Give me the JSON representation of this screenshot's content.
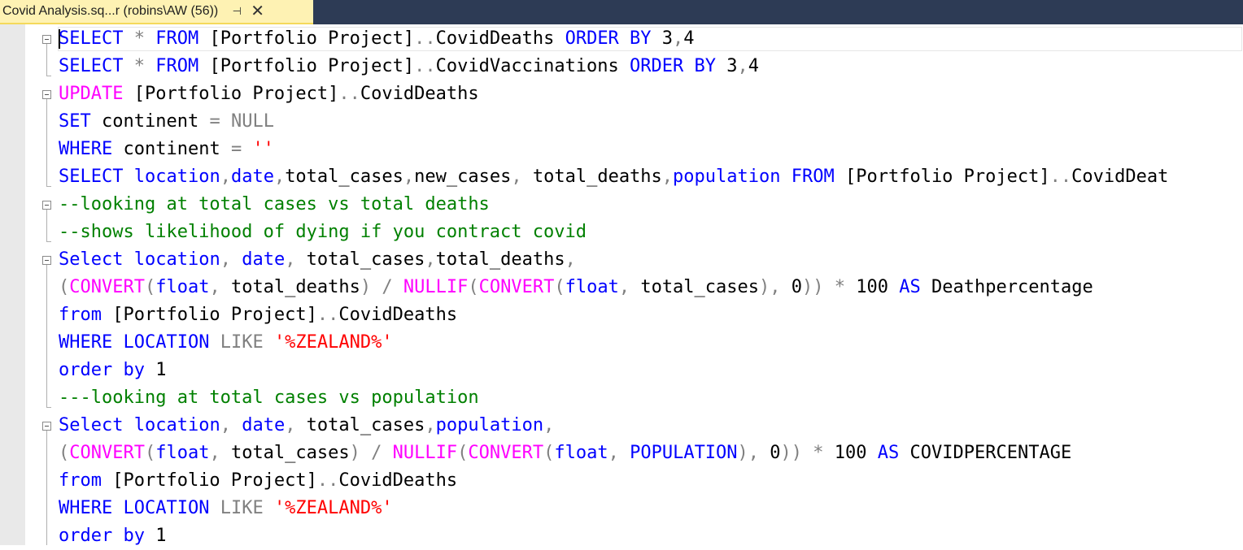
{
  "tab": {
    "title": "Covid Analysis.sq...r (robins\\AW (56))",
    "pin_icon": "⊣",
    "close_icon": "✕"
  },
  "editor": {
    "lines": [
      [
        [
          "kw",
          "SELECT"
        ],
        [
          "tx",
          " "
        ],
        [
          "op",
          "*"
        ],
        [
          "tx",
          " "
        ],
        [
          "kw",
          "FROM"
        ],
        [
          "tx",
          " [Portfolio Project]"
        ],
        [
          "op",
          ".."
        ],
        [
          "tx",
          "CovidDeaths "
        ],
        [
          "kw",
          "ORDER BY"
        ],
        [
          "tx",
          " 3"
        ],
        [
          "op",
          ","
        ],
        [
          "tx",
          "4"
        ]
      ],
      [
        [
          "kw",
          "SELECT"
        ],
        [
          "tx",
          " "
        ],
        [
          "op",
          "*"
        ],
        [
          "tx",
          " "
        ],
        [
          "kw",
          "FROM"
        ],
        [
          "tx",
          " [Portfolio Project]"
        ],
        [
          "op",
          ".."
        ],
        [
          "tx",
          "CovidVaccinations "
        ],
        [
          "kw",
          "ORDER BY"
        ],
        [
          "tx",
          " 3"
        ],
        [
          "op",
          ","
        ],
        [
          "tx",
          "4"
        ]
      ],
      [
        [
          "fn",
          "UPDATE"
        ],
        [
          "tx",
          " [Portfolio Project]"
        ],
        [
          "op",
          ".."
        ],
        [
          "tx",
          "CovidDeaths"
        ]
      ],
      [
        [
          "kw",
          "SET"
        ],
        [
          "tx",
          " continent "
        ],
        [
          "op",
          "="
        ],
        [
          "tx",
          " "
        ],
        [
          "op",
          "NULL"
        ]
      ],
      [
        [
          "kw",
          "WHERE"
        ],
        [
          "tx",
          " continent "
        ],
        [
          "op",
          "="
        ],
        [
          "tx",
          " "
        ],
        [
          "str",
          "''"
        ]
      ],
      [
        [
          "kw",
          "SELECT"
        ],
        [
          "tx",
          " "
        ],
        [
          "kw",
          "location"
        ],
        [
          "op",
          ","
        ],
        [
          "kw",
          "date"
        ],
        [
          "op",
          ","
        ],
        [
          "tx",
          "total_cases"
        ],
        [
          "op",
          ","
        ],
        [
          "tx",
          "new_cases"
        ],
        [
          "op",
          ","
        ],
        [
          "tx",
          " total_deaths"
        ],
        [
          "op",
          ","
        ],
        [
          "kw",
          "population"
        ],
        [
          "tx",
          " "
        ],
        [
          "kw",
          "FROM"
        ],
        [
          "tx",
          " [Portfolio Project]"
        ],
        [
          "op",
          ".."
        ],
        [
          "tx",
          "CovidDeat"
        ]
      ],
      [
        [
          "cm",
          "--looking at total cases vs total deaths"
        ]
      ],
      [
        [
          "cm",
          "--shows likelihood of dying if you contract covid"
        ]
      ],
      [
        [
          "kw",
          "Select"
        ],
        [
          "tx",
          " "
        ],
        [
          "kw",
          "location"
        ],
        [
          "op",
          ","
        ],
        [
          "tx",
          " "
        ],
        [
          "kw",
          "date"
        ],
        [
          "op",
          ","
        ],
        [
          "tx",
          " total_cases"
        ],
        [
          "op",
          ","
        ],
        [
          "tx",
          "total_deaths"
        ],
        [
          "op",
          ","
        ]
      ],
      [
        [
          "op",
          "("
        ],
        [
          "fn",
          "CONVERT"
        ],
        [
          "op",
          "("
        ],
        [
          "kw",
          "float"
        ],
        [
          "op",
          ","
        ],
        [
          "tx",
          " total_deaths"
        ],
        [
          "op",
          ")"
        ],
        [
          "tx",
          " "
        ],
        [
          "op",
          "/"
        ],
        [
          "tx",
          " "
        ],
        [
          "fn",
          "NULLIF"
        ],
        [
          "op",
          "("
        ],
        [
          "fn",
          "CONVERT"
        ],
        [
          "op",
          "("
        ],
        [
          "kw",
          "float"
        ],
        [
          "op",
          ","
        ],
        [
          "tx",
          " total_cases"
        ],
        [
          "op",
          "),"
        ],
        [
          "tx",
          " 0"
        ],
        [
          "op",
          "))"
        ],
        [
          "tx",
          " "
        ],
        [
          "op",
          "*"
        ],
        [
          "tx",
          " 100 "
        ],
        [
          "kw",
          "AS"
        ],
        [
          "tx",
          " Deathpercentage"
        ]
      ],
      [
        [
          "kw",
          "from"
        ],
        [
          "tx",
          " [Portfolio Project]"
        ],
        [
          "op",
          ".."
        ],
        [
          "tx",
          "CovidDeaths"
        ]
      ],
      [
        [
          "kw",
          "WHERE"
        ],
        [
          "tx",
          " "
        ],
        [
          "kw",
          "LOCATION"
        ],
        [
          "tx",
          " "
        ],
        [
          "op",
          "LIKE"
        ],
        [
          "tx",
          " "
        ],
        [
          "str",
          "'%ZEALAND%'"
        ]
      ],
      [
        [
          "kw",
          "order by"
        ],
        [
          "tx",
          " 1"
        ]
      ],
      [
        [
          "cm",
          "---looking at total cases vs population"
        ]
      ],
      [
        [
          "kw",
          "Select"
        ],
        [
          "tx",
          " "
        ],
        [
          "kw",
          "location"
        ],
        [
          "op",
          ","
        ],
        [
          "tx",
          " "
        ],
        [
          "kw",
          "date"
        ],
        [
          "op",
          ","
        ],
        [
          "tx",
          " total_cases"
        ],
        [
          "op",
          ","
        ],
        [
          "kw",
          "population"
        ],
        [
          "op",
          ","
        ]
      ],
      [
        [
          "op",
          "("
        ],
        [
          "fn",
          "CONVERT"
        ],
        [
          "op",
          "("
        ],
        [
          "kw",
          "float"
        ],
        [
          "op",
          ","
        ],
        [
          "tx",
          " total_cases"
        ],
        [
          "op",
          ")"
        ],
        [
          "tx",
          " "
        ],
        [
          "op",
          "/"
        ],
        [
          "tx",
          " "
        ],
        [
          "fn",
          "NULLIF"
        ],
        [
          "op",
          "("
        ],
        [
          "fn",
          "CONVERT"
        ],
        [
          "op",
          "("
        ],
        [
          "kw",
          "float"
        ],
        [
          "op",
          ","
        ],
        [
          "tx",
          " "
        ],
        [
          "kw",
          "POPULATION"
        ],
        [
          "op",
          "),"
        ],
        [
          "tx",
          " 0"
        ],
        [
          "op",
          "))"
        ],
        [
          "tx",
          " "
        ],
        [
          "op",
          "*"
        ],
        [
          "tx",
          " 100 "
        ],
        [
          "kw",
          "AS"
        ],
        [
          "tx",
          " COVIDPERCENTAGE"
        ]
      ],
      [
        [
          "kw",
          "from"
        ],
        [
          "tx",
          " [Portfolio Project]"
        ],
        [
          "op",
          ".."
        ],
        [
          "tx",
          "CovidDeaths"
        ]
      ],
      [
        [
          "kw",
          "WHERE"
        ],
        [
          "tx",
          " "
        ],
        [
          "kw",
          "LOCATION"
        ],
        [
          "tx",
          " "
        ],
        [
          "op",
          "LIKE"
        ],
        [
          "tx",
          " "
        ],
        [
          "str",
          "'%ZEALAND%'"
        ]
      ],
      [
        [
          "kw",
          "order by"
        ],
        [
          "tx",
          " 1"
        ]
      ]
    ]
  }
}
